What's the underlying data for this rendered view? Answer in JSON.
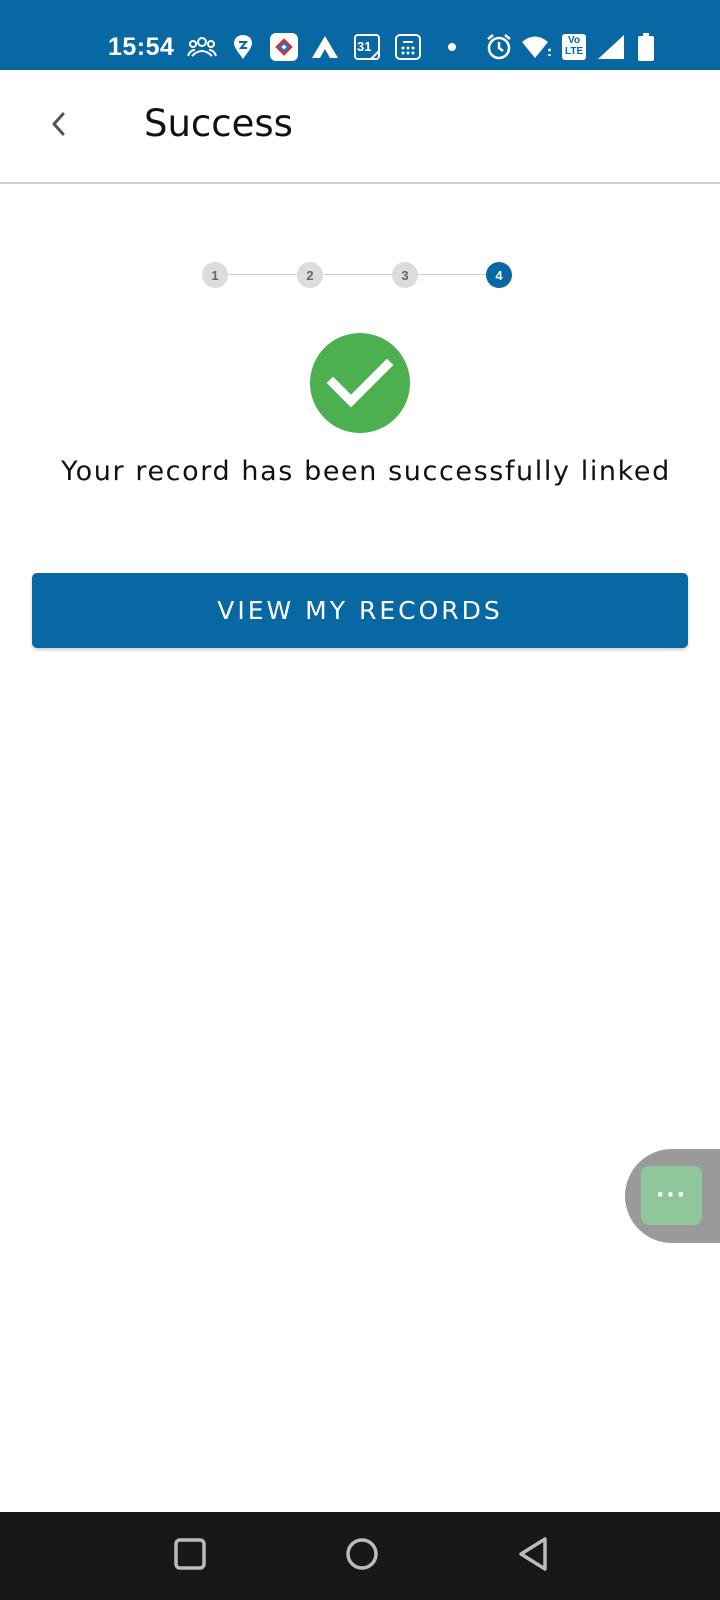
{
  "status_bar": {
    "time": "15:54",
    "icons": [
      "people-icon",
      "swiggy-icon",
      "app-icon",
      "axis-icon",
      "calendar-icon",
      "calculator-icon",
      "dot-icon",
      "alarm-icon",
      "wifi-icon",
      "volte-icon",
      "signal-icon",
      "battery-icon"
    ],
    "calendar_day": "31",
    "volte_label_top": "Vo",
    "volte_label_bottom": "LTE"
  },
  "header": {
    "title": "Success",
    "back_icon": "chevron-left-icon"
  },
  "stepper": {
    "steps": [
      "1",
      "2",
      "3",
      "4"
    ],
    "active_step": "4"
  },
  "result": {
    "icon": "check-circle-icon",
    "message": "Your record has been successfully linked"
  },
  "actions": {
    "primary_label": "VIEW MY RECORDS"
  },
  "chat_fab": {
    "label": "···",
    "icon": "chat-icon"
  },
  "colors": {
    "brand": "#0768a3",
    "success": "#4caf50"
  }
}
